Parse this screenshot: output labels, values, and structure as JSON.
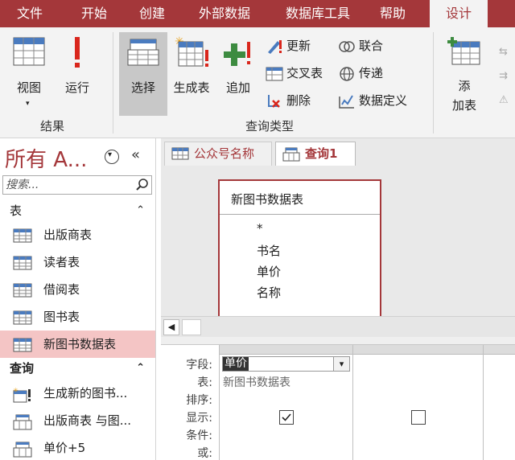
{
  "menubar": {
    "items": [
      "文件",
      "开始",
      "创建",
      "外部数据",
      "数据库工具",
      "帮助",
      "设计"
    ],
    "active": "设计"
  },
  "ribbon": {
    "results": {
      "view_label": "视图",
      "run_label": "运行",
      "group_label": "结果"
    },
    "query_type": {
      "select_label": "选择",
      "make_table_label": "生成表",
      "append_label": "追加",
      "update_label": "更新",
      "crosstab_label": "交叉表",
      "delete_label": "删除",
      "union_label": "联合",
      "passthrough_label": "传递",
      "data_definition_label": "数据定义",
      "group_label": "查询类型"
    },
    "add_table": {
      "label_line1": "添",
      "label_line2": "加表"
    }
  },
  "nav": {
    "title": "所有 A...",
    "search_placeholder": "搜索...",
    "tables_header": "表",
    "tables": [
      "出版商表",
      "读者表",
      "借阅表",
      "图书表",
      "新图书数据表"
    ],
    "selected_table": "新图书数据表",
    "queries_header": "查询",
    "queries": [
      "生成新的图书...",
      "出版商表 与图...",
      "单价+5"
    ]
  },
  "doc_tabs": [
    {
      "label": "公众号名称",
      "active": false
    },
    {
      "label": "查询1",
      "active": true
    }
  ],
  "design": {
    "table_name": "新图书数据表",
    "fields": [
      "*",
      "书名",
      "单价",
      "名称"
    ]
  },
  "grid": {
    "row_labels": [
      "字段:",
      "表:",
      "排序:",
      "显示:",
      "条件:",
      "或:"
    ],
    "columns": [
      {
        "field": "单价",
        "table": "新图书数据表",
        "show": true
      },
      {
        "field": "",
        "table": "",
        "show": false
      }
    ]
  },
  "colors": {
    "accent": "#a4373a",
    "ribbon_bg": "#f3f3f3",
    "nav_selected": "#f4c5c5"
  }
}
